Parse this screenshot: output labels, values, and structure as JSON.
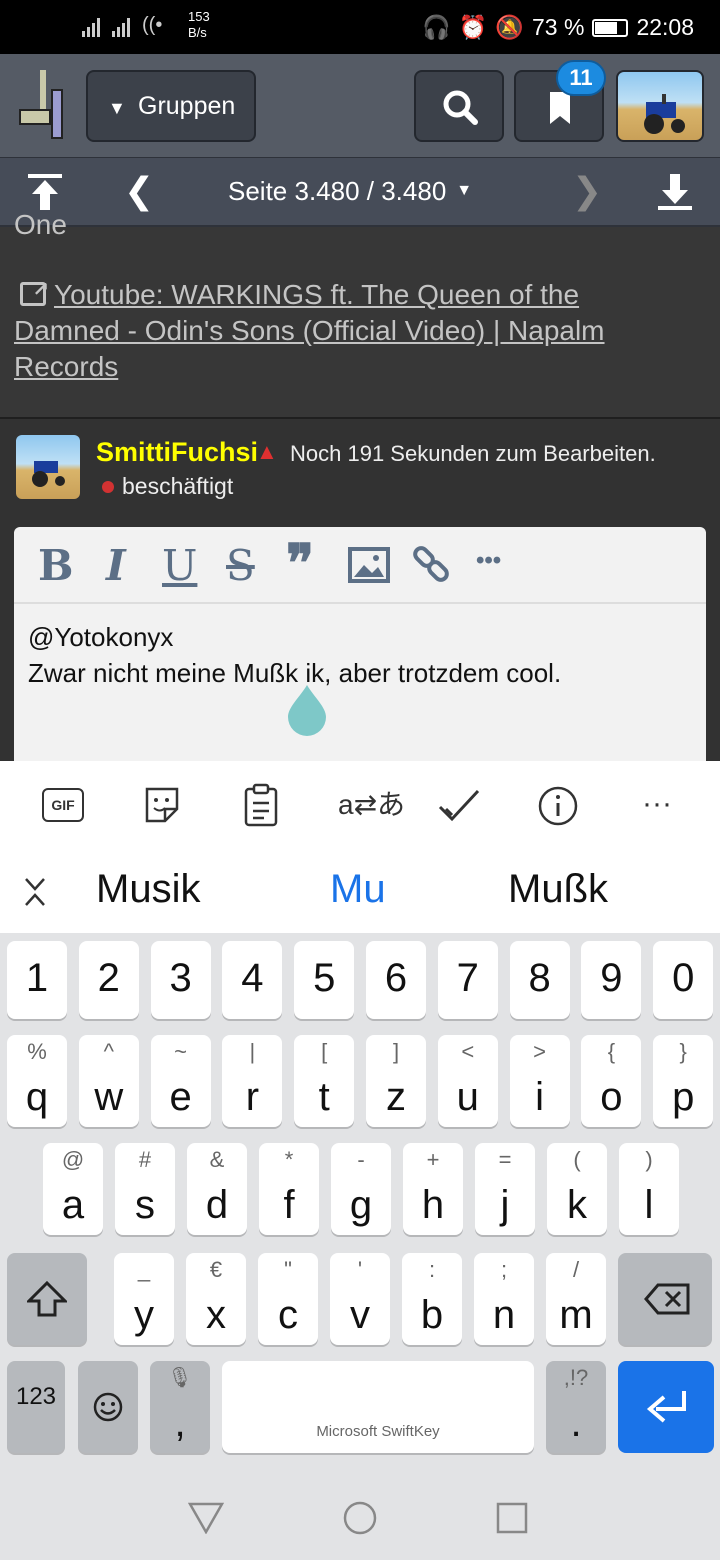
{
  "status_bar": {
    "net_speed_value": "153",
    "net_speed_unit": "B/s",
    "battery": "73 %",
    "time": "22:08"
  },
  "header": {
    "groups_label": "Gruppen",
    "bookmark_count": "11"
  },
  "pagenav": {
    "page_label": "Seite 3.480 / 3.480"
  },
  "post": {
    "cut_link": "One",
    "link_text": "Youtube: WARKINGS ft. The Queen of the Damned - Odin's Sons (Official Video) | Napalm Records"
  },
  "reply": {
    "username": "SmittiFuchsi",
    "edit_notice": "Noch 191 Sekunden zum Bearbeiten.",
    "status": "beschäftigt"
  },
  "editor": {
    "tools": {
      "bold": "B",
      "italic": "I",
      "underline": "U",
      "strike": "S",
      "more": "•••"
    },
    "line1": "@Yotokonyx",
    "line2": "Zwar nicht meine Mußk ik, aber trotzdem cool."
  },
  "keyboard": {
    "toolbar": {
      "gif": "GIF",
      "more": "···"
    },
    "suggestions": [
      "Musik",
      "Mu",
      "Mußk"
    ],
    "accent_color": "#1a73e8",
    "numbers": [
      "1",
      "2",
      "3",
      "4",
      "5",
      "6",
      "7",
      "8",
      "9",
      "0"
    ],
    "row1": [
      [
        "q",
        "%"
      ],
      [
        "w",
        "^"
      ],
      [
        "e",
        "~"
      ],
      [
        "r",
        "|"
      ],
      [
        "t",
        "["
      ],
      [
        "z",
        "]"
      ],
      [
        "u",
        "<"
      ],
      [
        "i",
        ">"
      ],
      [
        "o",
        "{"
      ],
      [
        "p",
        "}"
      ]
    ],
    "row2": [
      [
        "a",
        "@"
      ],
      [
        "s",
        "#"
      ],
      [
        "d",
        "&"
      ],
      [
        "f",
        "*"
      ],
      [
        "g",
        "-"
      ],
      [
        "h",
        "+"
      ],
      [
        "j",
        "="
      ],
      [
        "k",
        "("
      ],
      [
        "l",
        ")"
      ]
    ],
    "row3": [
      [
        "y",
        "_"
      ],
      [
        "x",
        "€"
      ],
      [
        "c",
        "\""
      ],
      [
        "v",
        "'"
      ],
      [
        "b",
        ":"
      ],
      [
        "n",
        ";"
      ],
      [
        "m",
        "/"
      ]
    ],
    "sym_key": "123",
    "comma": ",",
    "space_label": "Microsoft SwiftKey",
    "punct_sub": ",!?",
    "period": "."
  }
}
